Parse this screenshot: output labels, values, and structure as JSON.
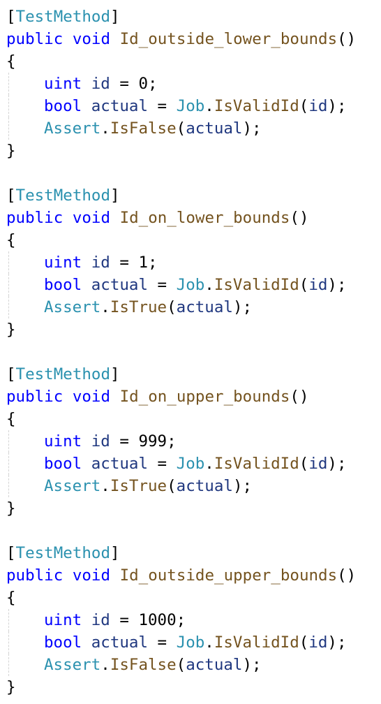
{
  "methods": [
    {
      "attribute": "TestMethod",
      "keyword_public": "public",
      "keyword_void": "void",
      "name": "Id_outside_lower_bounds",
      "type_uint": "uint",
      "var_id": "id",
      "id_value": "0",
      "type_bool": "bool",
      "var_actual": "actual",
      "class_job": "Job",
      "method_isvalid": "IsValidId",
      "class_assert": "Assert",
      "assert_method": "IsFalse"
    },
    {
      "attribute": "TestMethod",
      "keyword_public": "public",
      "keyword_void": "void",
      "name": "Id_on_lower_bounds",
      "type_uint": "uint",
      "var_id": "id",
      "id_value": "1",
      "type_bool": "bool",
      "var_actual": "actual",
      "class_job": "Job",
      "method_isvalid": "IsValidId",
      "class_assert": "Assert",
      "assert_method": "IsTrue"
    },
    {
      "attribute": "TestMethod",
      "keyword_public": "public",
      "keyword_void": "void",
      "name": "Id_on_upper_bounds",
      "type_uint": "uint",
      "var_id": "id",
      "id_value": "999",
      "type_bool": "bool",
      "var_actual": "actual",
      "class_job": "Job",
      "method_isvalid": "IsValidId",
      "class_assert": "Assert",
      "assert_method": "IsTrue"
    },
    {
      "attribute": "TestMethod",
      "keyword_public": "public",
      "keyword_void": "void",
      "name": "Id_outside_upper_bounds",
      "type_uint": "uint",
      "var_id": "id",
      "id_value": "1000",
      "type_bool": "bool",
      "var_actual": "actual",
      "class_job": "Job",
      "method_isvalid": "IsValidId",
      "class_assert": "Assert",
      "assert_method": "IsFalse"
    }
  ],
  "colors": {
    "keyword": "#0000ff",
    "type_name": "#2b91af",
    "method_name": "#74531f",
    "identifier": "#1f377f",
    "background": "#ffffff"
  }
}
